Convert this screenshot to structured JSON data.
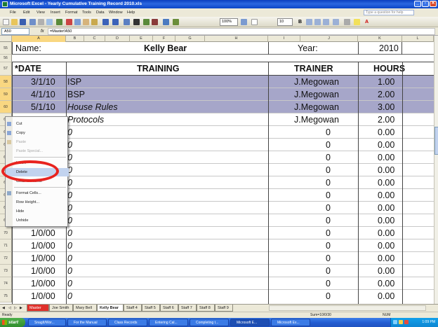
{
  "window": {
    "title": "Microsoft Excel - Yearly Cumulative Training Record 2010.xls",
    "buttons": [
      "_",
      "▫",
      "✕"
    ]
  },
  "menubar": {
    "items": [
      "File",
      "Edit",
      "View",
      "Insert",
      "Format",
      "Tools",
      "Data",
      "Window",
      "Help"
    ],
    "ask_placeholder": "Type a question for help"
  },
  "toolbar": {
    "zoom": "100%",
    "font_size": "10"
  },
  "formula_bar": {
    "name_box": "A50",
    "fx": "fx",
    "formula": "=Master!A50"
  },
  "columns": [
    "A",
    "B",
    "C",
    "D",
    "E",
    "F",
    "G",
    "H",
    "I",
    "J",
    "K",
    "L"
  ],
  "sheet": {
    "name_row": {
      "row": "55",
      "label": "Name:",
      "name": "Kelly Bear",
      "year_label": "Year:",
      "year": "2010"
    },
    "blank_row": "56",
    "header_row": {
      "row": "57",
      "date": "*DATE",
      "training": "TRAINING",
      "trainer": "TRAINER",
      "hours": "HOURS"
    },
    "rows": [
      {
        "row": "58",
        "date": "3/1/10",
        "training": "ISP",
        "trainer": "J.Megowan",
        "hours": "1.00"
      },
      {
        "row": "59",
        "date": "4/1/10",
        "training": "BSP",
        "trainer": "J.Megowan",
        "hours": "2.00"
      },
      {
        "row": "60",
        "date": "5/1/10",
        "training": "House Rules",
        "trainer": "J.Megowan",
        "hours": "3.00"
      },
      {
        "row": "61",
        "date": "",
        "training": "Protocols",
        "trainer": "J.Megowan",
        "hours": "2.00"
      },
      {
        "row": "62",
        "date": "",
        "training": "0",
        "trainer": "0",
        "hours": "0.00"
      },
      {
        "row": "63",
        "date": "",
        "training": "0",
        "trainer": "0",
        "hours": "0.00"
      },
      {
        "row": "64",
        "date": "",
        "training": "0",
        "trainer": "0",
        "hours": "0.00"
      },
      {
        "row": "65",
        "date": "",
        "training": "0",
        "trainer": "0",
        "hours": "0.00"
      },
      {
        "row": "66",
        "date": "",
        "training": "0",
        "trainer": "0",
        "hours": "0.00"
      },
      {
        "row": "67",
        "date": "",
        "training": "0",
        "trainer": "0",
        "hours": "0.00"
      },
      {
        "row": "68",
        "date": "",
        "training": "0",
        "trainer": "0",
        "hours": "0.00"
      },
      {
        "row": "69",
        "date": "",
        "training": "0",
        "trainer": "0",
        "hours": "0.00"
      },
      {
        "row": "70",
        "date": "1/0/00",
        "training": "0",
        "trainer": "0",
        "hours": "0.00"
      },
      {
        "row": "71",
        "date": "1/0/00",
        "training": "0",
        "trainer": "0",
        "hours": "0.00"
      },
      {
        "row": "72",
        "date": "1/0/00",
        "training": "0",
        "trainer": "0",
        "hours": "0.00"
      },
      {
        "row": "73",
        "date": "1/0/00",
        "training": "0",
        "trainer": "0",
        "hours": "0.00"
      },
      {
        "row": "74",
        "date": "1/0/00",
        "training": "0",
        "trainer": "0",
        "hours": "0.00"
      },
      {
        "row": "75",
        "date": "1/0/00",
        "training": "0",
        "trainer": "0",
        "hours": "0.00"
      },
      {
        "row": "76",
        "date": "1/0/00",
        "training": "0",
        "trainer": "0",
        "hours": "0.00"
      }
    ]
  },
  "context_menu": {
    "items": [
      "Cut",
      "Copy",
      "Paste",
      "Paste Special...",
      "Insert",
      "Delete",
      "Clear Contents",
      "Format Cells...",
      "Row Height...",
      "Hide",
      "Unhide"
    ],
    "highlighted": "Delete"
  },
  "sheet_tabs": [
    "Master",
    "Joe Smith",
    "Mary Bell",
    "Kelly Bear",
    "Staff 4",
    "Staff 5",
    "Staff 6",
    "Staff 7",
    "Staff 8",
    "Staff 9"
  ],
  "active_tab": "Kelly Bear",
  "status": {
    "left": "Ready",
    "sum": "Sum=10/0/30",
    "num": "NUM"
  },
  "taskbar": {
    "start": "start",
    "tasks": [
      "SnagIt/Wor...",
      "For the Manual",
      "Class Records",
      "Entering Cal...",
      "Completing t...",
      "Microsoft E...",
      "Microsoft Ex..."
    ],
    "clock": "1:09 PM"
  },
  "colors": {
    "highlight": "#a6a6c9",
    "selection_header": "#f9d781",
    "annotation": "#e8231f",
    "titlebar": "#0a3fbf"
  }
}
